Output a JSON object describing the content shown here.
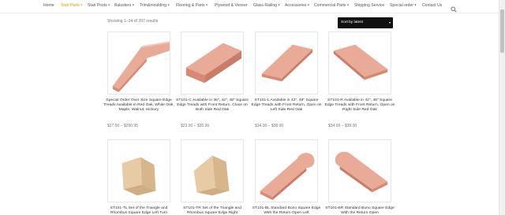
{
  "nav": {
    "items": [
      {
        "label": "Home",
        "caret": false
      },
      {
        "label": "Stair Parts",
        "caret": true,
        "active": true
      },
      {
        "label": "Stair Posts",
        "caret": true
      },
      {
        "label": "Balusters",
        "caret": true
      },
      {
        "label": "Trim&moulding",
        "caret": true
      },
      {
        "label": "Flooring & Parts",
        "caret": true
      },
      {
        "label": "Plywood & Veneer",
        "caret": false
      },
      {
        "label": "Glass Railing",
        "caret": true
      },
      {
        "label": "Accessories",
        "caret": true
      },
      {
        "label": "Commercial Parts",
        "caret": true
      },
      {
        "label": "Shipping Service",
        "caret": false
      },
      {
        "label": "Special order",
        "caret": true
      },
      {
        "label": "Contact Us",
        "caret": false
      }
    ],
    "caret_glyph": "▾",
    "search_icon": "search-icon",
    "active_color": "#e09900"
  },
  "toolbar": {
    "result_count": "Showing 1–24 of 207 results",
    "sort_label": "Sort by latest",
    "sort_caret": "▾"
  },
  "products": [
    {
      "title": "Special Order Over Size Square Edge Treads Available in Red Oak, White Oak, Maple, Walnut, Hickory",
      "price": "$27.50 – $290.95",
      "shape": "tread-return-left"
    },
    {
      "title": "ST101-C Available in 36\", 42\", 48\" Square Edge Treads with Front Return, Close on Both Side Red Oak",
      "price": "$23.00 – $35.00",
      "shape": "tread-closed"
    },
    {
      "title": "ST101-L Available in 42\", 48\" Square Edge Treads with Front Return, Open on Left Side Red Oak",
      "price": "$34.00 – $38.00",
      "shape": "tread-flat"
    },
    {
      "title": "ST101-R Available in 42\", 48\" Square Edge Treads with Front Return, Open on Right Side Red Oak",
      "price": "$34.00 – $38.00",
      "shape": "tread-flat"
    },
    {
      "title": "ST101-TL Set of the Triangle and Rhombus Square Edge Left Turn",
      "price": "",
      "shape": "triangle-set"
    },
    {
      "title": "ST101-TR Set of the Triangle and Rhombus Square Edge Right",
      "price": "",
      "shape": "triangle-set"
    },
    {
      "title": "ST101-BL Standard Buno Square Edge With the Return Open Left",
      "price": "",
      "shape": "bullnose-left"
    },
    {
      "title": "ST101-BR Standard Buno Square Edge With the Return Open",
      "price": "",
      "shape": "bullnose-right"
    }
  ],
  "colors": {
    "wood_top": "#e9aa97",
    "wood_edge": "#d68a74",
    "wood_light": "#e6cba4",
    "wood_light_edge": "#cfae84",
    "sort_bg": "#111111"
  }
}
